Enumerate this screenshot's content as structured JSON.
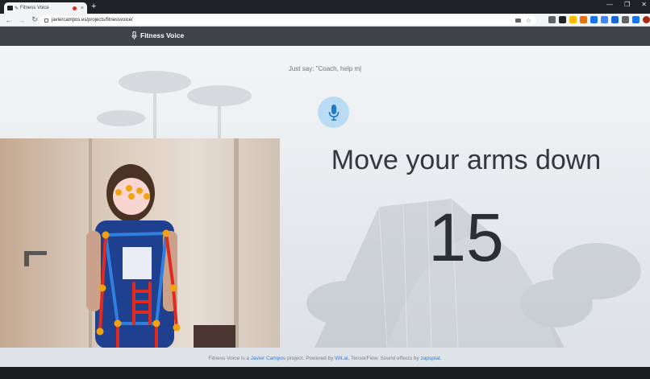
{
  "browser": {
    "tab_title": "Fitness Voice",
    "new_tab_symbol": "+",
    "tab_close": "×",
    "url": "javiercampos.es/projects/fitnessvoice/",
    "window_controls": [
      "—",
      "❐",
      "✕"
    ],
    "nav": {
      "back": "←",
      "forward": "→",
      "reload": "↻"
    },
    "bookmark_star": "☆",
    "menu": "⋮",
    "extension_colors": [
      "#5f6368",
      "#202124",
      "#fbbc04",
      "#e8710a",
      "#1a73e8",
      "#4285f4",
      "#1967d2",
      "#5f6368",
      "#1a73e8"
    ]
  },
  "app": {
    "title": "Fitness Voice",
    "logo_icon": "microphone-icon"
  },
  "main": {
    "prompt_text": "Just say: \"Coach, help m|",
    "mic_icon": "microphone-icon",
    "instruction": "Move your arms down",
    "count": "15"
  },
  "footer": {
    "text1": "Fitness Voice is a ",
    "link1": "Javier Campos",
    "text2": " project. Powered by ",
    "link2": "Wit.ai",
    "text3": ", TensorFlow. Sound effects by ",
    "link3": "zapsplat",
    "text4": "."
  },
  "colors": {
    "appbar": "#3e4448",
    "mic_circle": "#b9dbf3",
    "mic": "#1f78c8",
    "link": "#3b78d8",
    "skeleton_blue": "#2f7fe0",
    "skeleton_red": "#e02a1d",
    "keypoint": "#f2a20f"
  }
}
